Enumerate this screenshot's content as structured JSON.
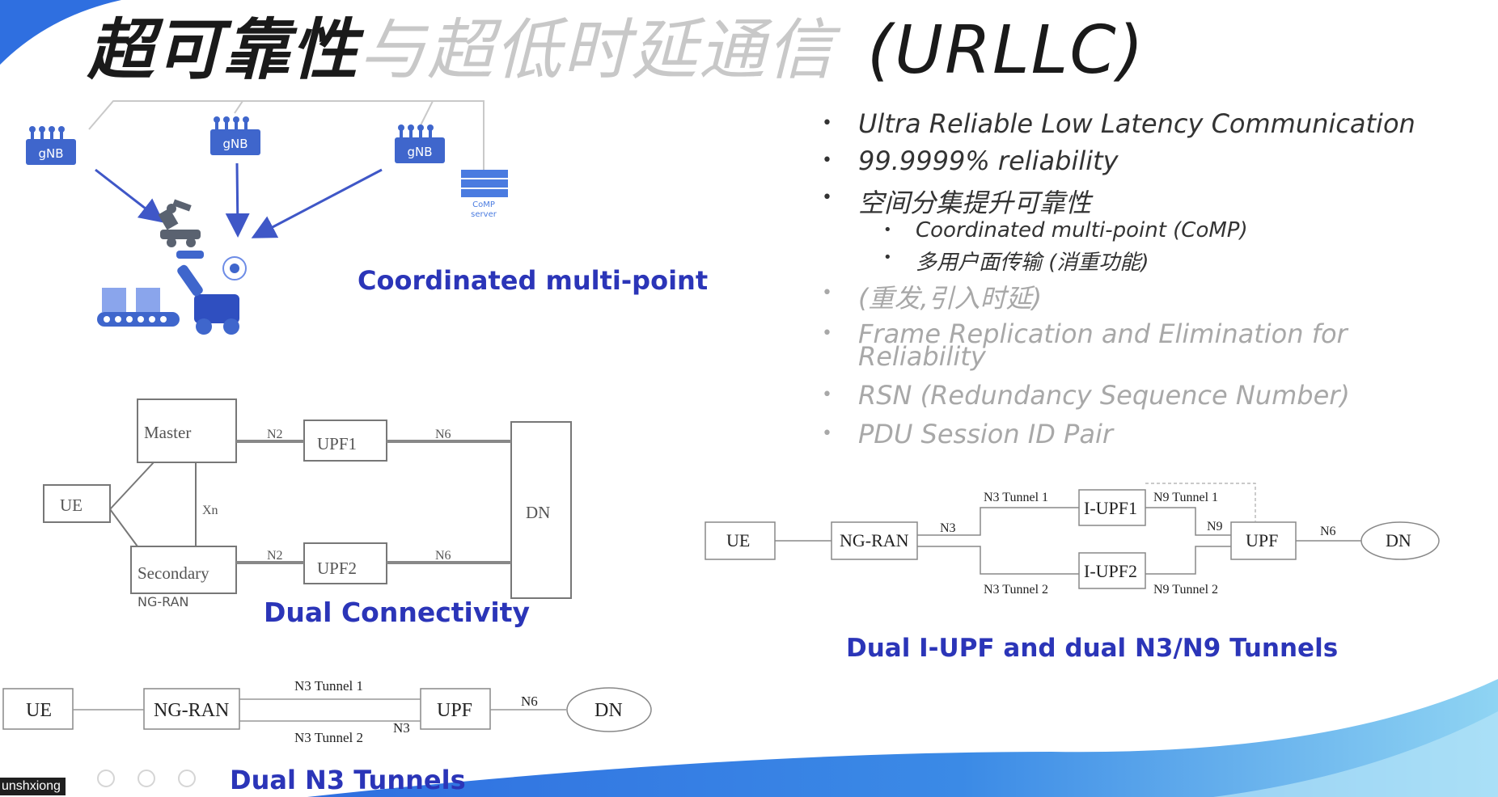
{
  "title": {
    "dark": "超可靠性",
    "light": "与超低时延通信",
    "en": "(URLLC)"
  },
  "bullets": [
    {
      "text": "Ultra Reliable Low  Latency Communication",
      "level": 1,
      "dim": false
    },
    {
      "text": "99.9999% reliability",
      "level": 1,
      "dim": false
    },
    {
      "text": "空间分集提升可靠性",
      "level": 1,
      "dim": false
    },
    {
      "text": "Coordinated multi-point (CoMP)",
      "level": 2,
      "dim": false
    },
    {
      "text": "多用户面传输  (消重功能)",
      "level": 2,
      "dim": false
    },
    {
      "text": "  (重发,引入时延)",
      "level": 1,
      "dim": true
    },
    {
      "text": "Frame Replication and Elimination for",
      "level": 1,
      "dim": true
    },
    {
      "text": "Reliability",
      "level": 1,
      "dim": true
    },
    {
      "text": "RSN  (Redundancy Sequence Number)",
      "level": 1,
      "dim": true
    },
    {
      "text": "PDU Session ID Pair",
      "level": 1,
      "dim": true
    }
  ],
  "comp": {
    "gnb_labels": [
      "gNB",
      "gNB",
      "gNB"
    ],
    "server_label_1": "CoMP",
    "server_label_2": "server",
    "caption": "Coordinated multi-point"
  },
  "dual_connectivity": {
    "master": "Master",
    "secondary": "Secondary",
    "ue": "UE",
    "upf1": "UPF1",
    "upf2": "UPF2",
    "dn": "DN",
    "n2_top": "N2",
    "n2_bottom": "N2",
    "n6_top": "N6",
    "n6_bottom": "N6",
    "xn": "Xn",
    "ng_ran_partial": "NG-RAN",
    "caption": "Dual Connectivity"
  },
  "dual_n3": {
    "ue": "UE",
    "ng_ran": "NG-RAN",
    "upf": "UPF",
    "dn": "DN",
    "n3_tunnel_1": "N3 Tunnel 1",
    "n3_tunnel_2": "N3 Tunnel 2",
    "n3": "N3",
    "n6": "N6",
    "caption": "Dual N3 Tunnels"
  },
  "dual_iupf": {
    "ue": "UE",
    "ng_ran": "NG-RAN",
    "iupf1": "I-UPF1",
    "iupf2": "I-UPF2",
    "upf": "UPF",
    "dn": "DN",
    "n3": "N3",
    "n3_tunnel_1": "N3 Tunnel 1",
    "n3_tunnel_2": "N3 Tunnel 2",
    "n9_tunnel_1": "N9 Tunnel 1",
    "n9_tunnel_2": "N9 Tunnel 2",
    "n9": "N9",
    "n6": "N6",
    "caption": "Dual I-UPF and dual N3/N9 Tunnels"
  },
  "user_tag": "unshxiong",
  "colors": {
    "caption_blue": "#2b35b8",
    "accent_blue": "#3f57c7",
    "wave_light": "#8fd4f3",
    "wave_dark": "#2f6fe0"
  }
}
